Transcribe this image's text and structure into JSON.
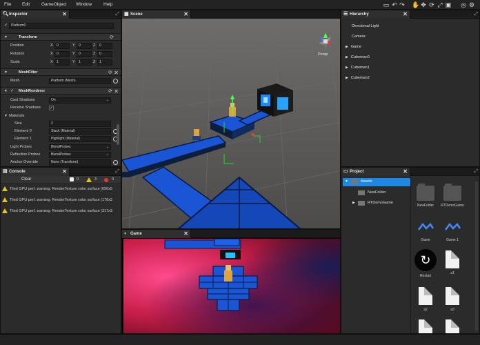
{
  "menubar": {
    "items": [
      "File",
      "Edit",
      "GameObject",
      "Window",
      "Help"
    ]
  },
  "inspector": {
    "tab_label": "Inspector",
    "object_name": "Platform0",
    "transform": {
      "header": "Transform",
      "position_label": "Position",
      "rotation_label": "Rotation",
      "scale_label": "Scale",
      "position": {
        "x": "0",
        "y": "0",
        "z": "0"
      },
      "rotation": {
        "x": "0",
        "y": "0",
        "z": "0"
      },
      "scale": {
        "x": "1",
        "y": "1",
        "z": "1"
      },
      "axis_x": "X",
      "axis_y": "Y",
      "axis_z": "Z"
    },
    "meshfilter": {
      "header": "MeshFilter",
      "mesh_label": "Mesh",
      "mesh_value": "Platform (Mesh)"
    },
    "meshrenderer": {
      "header": "MeshRenderer",
      "cast_shadows_label": "Cast Shadows",
      "cast_shadows_value": "On",
      "receive_shadows_label": "Receive Shadows",
      "materials_label": "Materials",
      "size_label": "Size",
      "size_value": "2",
      "element0_label": "Element 0",
      "element0_value": "Stack (Material)",
      "element1_label": "Element 1",
      "element1_value": "Highlight (Material)",
      "light_probes_label": "Light Probes",
      "light_probes_value": "BlendProbes",
      "reflection_probes_label": "Reflection Probes",
      "reflection_probes_value": "BlendProbes",
      "anchor_override_label": "Anchor Override",
      "anchor_override_value": "None (Transform)"
    }
  },
  "console": {
    "tab_label": "Console",
    "clear_label": "Clear",
    "info_count": "0",
    "warning_count": "3",
    "error_count": "0",
    "messages": [
      "Tiled GPU perf. warning: RenderTexture color surface (696x5",
      "Tiled GPU perf. warning: RenderTexture color surface (178x2",
      "Tiled GPU perf. warning: RenderTexture color surface (317x3"
    ]
  },
  "scene": {
    "tab_label": "Scene",
    "gizmo_label": "Persp"
  },
  "game": {
    "tab_label": "Game"
  },
  "hierarchy": {
    "tab_label": "Hierarchy",
    "items": [
      {
        "label": "Directional Light",
        "expandable": false
      },
      {
        "label": "Camera",
        "expandable": false
      },
      {
        "label": "Game",
        "expandable": true
      },
      {
        "label": "Cubeman0",
        "expandable": true
      },
      {
        "label": "Cubeman1",
        "expandable": true
      },
      {
        "label": "Cubeman2",
        "expandable": true
      }
    ]
  },
  "project": {
    "tab_label": "Project",
    "tree": [
      {
        "label": "Assets",
        "selected": true
      },
      {
        "label": "NewFolder",
        "selected": false
      },
      {
        "label": "RTDemoGame",
        "selected": false
      }
    ],
    "assets": [
      {
        "label": "NewFolder",
        "kind": "folder"
      },
      {
        "label": "RTDemoGame",
        "kind": "folder"
      },
      {
        "label": "Game",
        "kind": "material"
      },
      {
        "label": "Game 1",
        "kind": "material"
      },
      {
        "label": "Restart",
        "kind": "restart"
      },
      {
        "label": "a1",
        "kind": "doc"
      },
      {
        "label": "a2",
        "kind": "doc"
      },
      {
        "label": "a3",
        "kind": "doc"
      },
      {
        "label": "",
        "kind": "doc"
      },
      {
        "label": "",
        "kind": "doc"
      }
    ]
  },
  "colors": {
    "accent_blue": "#1e88e5",
    "warning_yellow": "#e8c21c",
    "error_red": "#e53935",
    "panel_bg": "#2b2b2b"
  }
}
